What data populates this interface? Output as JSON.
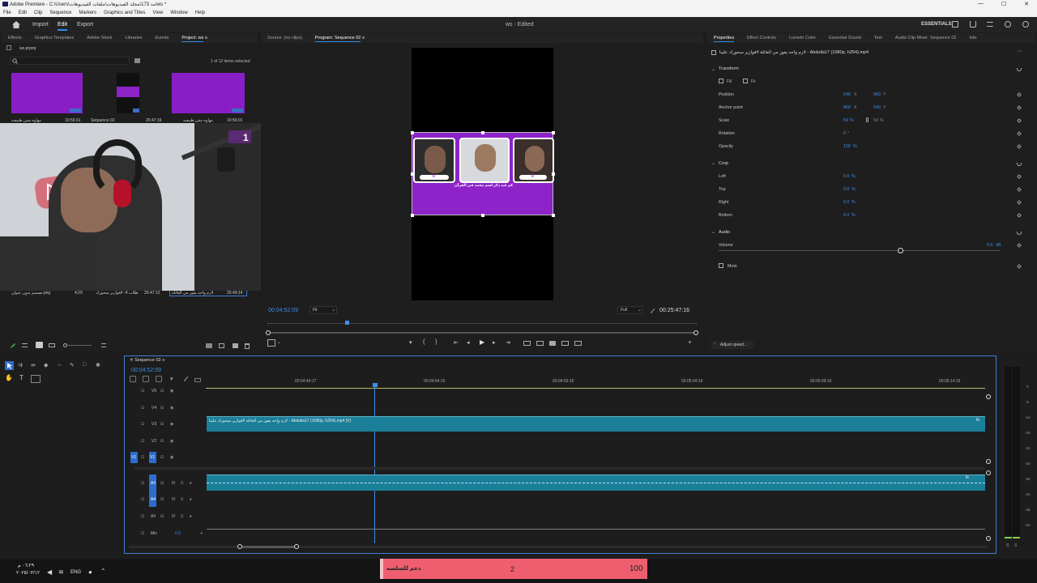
{
  "window": {
    "title": "Adobe Premiere - C:\\Users\\مد 173\\مجلد الفيديوهات\\ملفات الفيديوهات\\ws *",
    "controls": [
      "—",
      "☐",
      "✕"
    ]
  },
  "menu": [
    "File",
    "Edit",
    "Clip",
    "Sequence",
    "Markers",
    "Graphics and Titles",
    "View",
    "Window",
    "Help"
  ],
  "header": {
    "nav": [
      "Import",
      "Edit",
      "Export"
    ],
    "active": "Edit",
    "center_title": "ws - Edited",
    "workspace": "ESSENTIALS"
  },
  "project": {
    "tabs": [
      "Effects",
      "Graphics Templates",
      "Adobe Stock",
      "Libraries",
      "Events",
      "Project: ws"
    ],
    "active_tab": "Project: ws",
    "filename": "ws.prproj",
    "count": "1 of 12 items selected",
    "items": [
      {
        "name": "مهاوه مش طبيعيه",
        "duration": "19:56:01"
      },
      {
        "name": "Sequence 02",
        "duration": "25:47:16"
      },
      {
        "name": "مهاوه مش طبيعيه",
        "duration": "19:56:01"
      }
    ],
    "bottom_items": [
      {
        "name": "تصميم بدون عنوان.png",
        "duration": "4;29"
      },
      {
        "name": "طلاب 4- #فوازير سحورك",
        "duration": "25:47:12"
      },
      {
        "name": "لازم واحد يفوز من العائلة",
        "duration": "25:49:14"
      }
    ],
    "webcam_score": {
      "left": "1",
      "right_k": "K",
      "right": "4"
    }
  },
  "program": {
    "tabs": [
      "Source: (no clips)",
      "Program: Sequence 02"
    ],
    "active_tab": "Program: Sequence 02",
    "timecode": "00:04:52:09",
    "fit": "Fit",
    "quality": "Full",
    "duration": "00:25:47:16",
    "caption": "كم عيد ذكر اسم محمد في القرآن",
    "scores": [
      "0",
      "0",
      "0"
    ]
  },
  "properties": {
    "tabs": [
      "Properties",
      "Effect Controls",
      "Lumetri Color",
      "Essential Sound",
      "Text",
      "Audio Clip Mixer: Sequence 02",
      "Info"
    ],
    "active_tab": "Properties",
    "clip_name": "لازم واحد يفوز من العائلة #فوازير سحورك علينا - Abdulla17 (1080p, h264).mp4",
    "transform": {
      "heading": "Transform",
      "fill": "Fill",
      "fit": "Fit",
      "position_label": "Position",
      "position_x": "540",
      "position_y": "960",
      "anchor_label": "Anchor point",
      "anchor_x": "960",
      "anchor_y": "540",
      "scale_label": "Scale",
      "scale_v": "59",
      "scale_h": "59",
      "rotation_label": "Rotation",
      "rotation": "0",
      "opacity_label": "Opacity",
      "opacity": "100"
    },
    "crop": {
      "heading": "Crop",
      "left_label": "Left",
      "left": "0.0",
      "top_label": "Top",
      "top": "0.0",
      "right_label": "Right",
      "right": "0.0",
      "bottom_label": "Bottom",
      "bottom": "0.0"
    },
    "audio": {
      "heading": "Audio",
      "volume_label": "Volume",
      "volume": "0.0",
      "mute_label": "Mute"
    },
    "adjust_speed": "Adjust speed...",
    "units": {
      "x": "X",
      "y": "Y",
      "pct": "%",
      "deg": "°",
      "db": "dB"
    }
  },
  "timeline": {
    "tab": "Sequence 02",
    "timecode": "00:04:52:09",
    "ruler": [
      "00:04:49:17",
      "00:04:54:16",
      "00:04:59:16",
      "00:05:04:16",
      "00:05:09:16",
      "00:05:14:16"
    ],
    "video_tracks": [
      "V5",
      "V4",
      "V3",
      "V2",
      "V1"
    ],
    "audio_tracks": [
      "A3",
      "A4",
      "A5"
    ],
    "source_patch": "V1",
    "mix_label": "Mix",
    "mix_value": "0.0",
    "clip_label": "لازم واحد يفوز من العائلة #فوازير سحورك علينا - Abdulla17 (1080p, h264).mp4 [V]",
    "track_m": "M",
    "track_s": "S"
  },
  "meters": {
    "scale": [
      "0",
      "-6",
      "-12",
      "-18",
      "-24",
      "-30",
      "-36",
      "-42",
      "-48",
      "-54"
    ],
    "bottom_labels": [
      "S",
      "S"
    ]
  },
  "taskbar": {
    "time": "٠٦:٢٩ م",
    "date": "٢٠٢٥/٠٣/١٢",
    "lang": "ENG"
  },
  "donate": {
    "label": "دعم للسلسه",
    "count": "2",
    "goal": "100"
  },
  "colors": {
    "accent": "#2d8ceb",
    "purple": "#8d23c8",
    "clip": "#1c7f9a",
    "donate": "#ef5e6f"
  }
}
